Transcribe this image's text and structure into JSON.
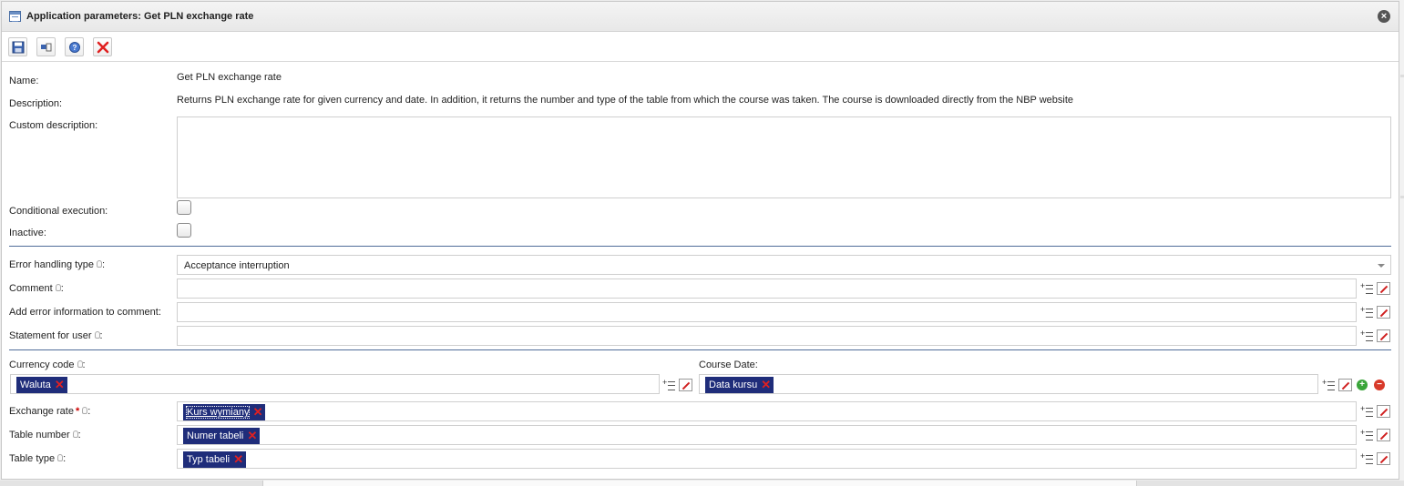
{
  "window": {
    "title": "Application parameters: Get PLN exchange rate"
  },
  "toolbar": {
    "buttons": [
      "save-icon",
      "exit-icon",
      "help-icon",
      "cancel-icon"
    ]
  },
  "form": {
    "name_label": "Name:",
    "name_value": "Get PLN exchange rate",
    "description_label": "Description:",
    "description_value": "Returns PLN exchange rate for given currency and date. In addition, it returns the number and type of the table from which the course was taken. The course is downloaded directly from the NBP website",
    "custom_description_label": "Custom description:",
    "custom_description_value": "",
    "conditional_execution_label": "Conditional execution:",
    "conditional_execution_checked": false,
    "inactive_label": "Inactive:",
    "inactive_checked": false,
    "error_handling_label": "Error handling type",
    "error_handling_value": "Acceptance interruption",
    "comment_label": "Comment",
    "comment_value": "",
    "add_error_label": "Add error information to comment:",
    "add_error_value": "",
    "statement_label": "Statement for user",
    "statement_value": "",
    "currency_code_label": "Currency code",
    "currency_code_tag": "Waluta",
    "course_date_label": "Course Date:",
    "course_date_tag": "Data kursu",
    "exchange_rate_label": "Exchange rate",
    "exchange_rate_required": "*",
    "exchange_rate_tag": "Kurs wymiany",
    "table_number_label": "Table number",
    "table_number_tag": "Numer tabeli",
    "table_type_label": "Table type",
    "table_type_tag": "Typ tabeli",
    "colon": ":"
  },
  "colors": {
    "tag_bg": "#1f2d7a",
    "separator": "#4f6d98",
    "remove_x": "#e02020"
  }
}
